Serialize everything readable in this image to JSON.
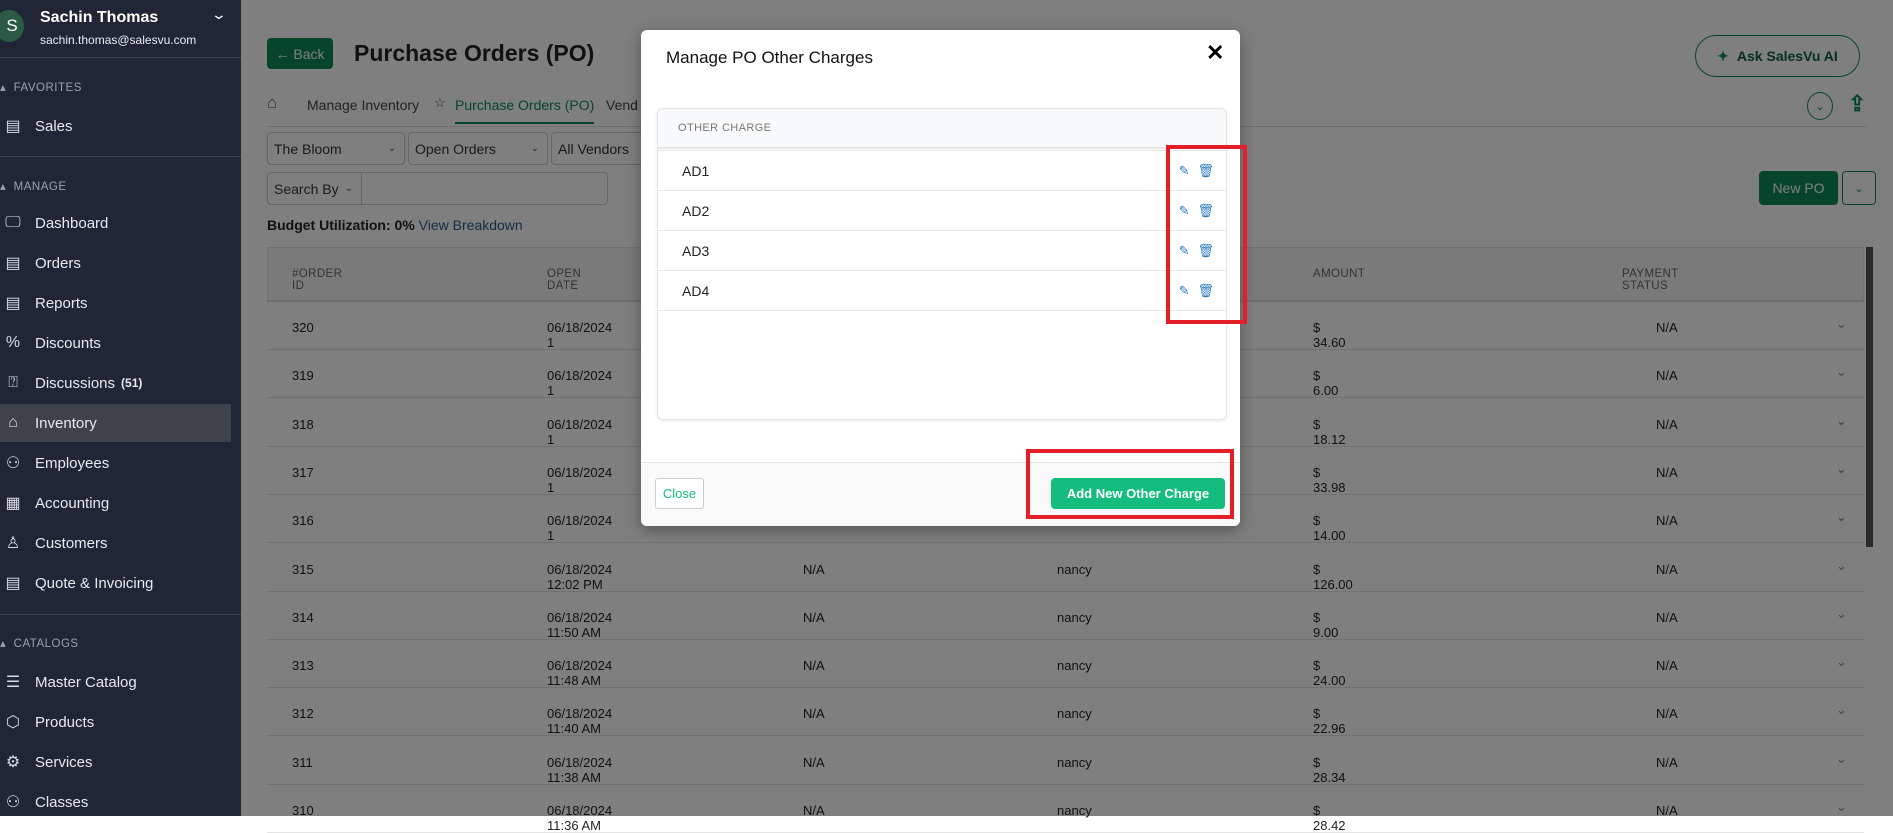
{
  "user": {
    "initial": "S",
    "name": "Sachin Thomas",
    "email": "sachin.thomas@salesvu.com"
  },
  "sidebar": {
    "sections": [
      {
        "label": "FAVORITES"
      },
      {
        "label": "MANAGE"
      },
      {
        "label": "CATALOGS"
      }
    ],
    "favorites": [
      {
        "label": "Sales",
        "icon": "sales-report-icon"
      }
    ],
    "manage": [
      {
        "label": "Dashboard",
        "icon": "monitor-icon"
      },
      {
        "label": "Orders",
        "icon": "orders-icon"
      },
      {
        "label": "Reports",
        "icon": "reports-icon"
      },
      {
        "label": "Discounts",
        "icon": "percent-icon"
      },
      {
        "label": "Discussions",
        "badge": "(51)",
        "icon": "chat-question-icon"
      },
      {
        "label": "Inventory",
        "icon": "store-icon",
        "active": true
      },
      {
        "label": "Employees",
        "icon": "people-icon"
      },
      {
        "label": "Accounting",
        "icon": "calculator-icon"
      },
      {
        "label": "Customers",
        "icon": "customer-icon"
      },
      {
        "label": "Quote & Invoicing",
        "icon": "invoice-icon"
      }
    ],
    "catalogs": [
      {
        "label": "Master Catalog",
        "icon": "list-icon"
      },
      {
        "label": "Products",
        "icon": "box-icon"
      },
      {
        "label": "Services",
        "icon": "gear-wrench-icon"
      },
      {
        "label": "Classes",
        "icon": "group-icon"
      }
    ]
  },
  "header": {
    "back": "Back",
    "title": "Purchase Orders (PO)",
    "ask_ai": "Ask SalesVu AI"
  },
  "breadcrumb": {
    "home": "Manage Inventory",
    "current": "Purchase Orders (PO)",
    "next": "Vend"
  },
  "filters": {
    "location": "The Bloom",
    "status": "Open Orders",
    "vendor": "All Vendors",
    "search_by": "Search By",
    "search_value": ""
  },
  "new_po": "New PO",
  "budget": {
    "label": "Budget Utilization: 0%",
    "link": "View Breakdown"
  },
  "table": {
    "headers": {
      "order_id": "#ORDER ID",
      "open_date": "OPEN DATE",
      "amount": "AMOUNT",
      "payment_status": "PAYMENT STATUS"
    },
    "rows": [
      {
        "id": "320",
        "date": "06/18/2024 1",
        "c3": "",
        "c4": "",
        "amount": "$ 34.60",
        "status": "N/A"
      },
      {
        "id": "319",
        "date": "06/18/2024 1",
        "c3": "",
        "c4": "",
        "amount": "$ 6.00",
        "status": "N/A"
      },
      {
        "id": "318",
        "date": "06/18/2024 1",
        "c3": "",
        "c4": "",
        "amount": "$ 18.12",
        "status": "N/A"
      },
      {
        "id": "317",
        "date": "06/18/2024 1",
        "c3": "",
        "c4": "",
        "amount": "$ 33.98",
        "status": "N/A"
      },
      {
        "id": "316",
        "date": "06/18/2024 1",
        "c3": "",
        "c4": "",
        "amount": "$ 14.00",
        "status": "N/A"
      },
      {
        "id": "315",
        "date": "06/18/2024 12:02 PM",
        "c3": "N/A",
        "c4": "nancy",
        "amount": "$ 126.00",
        "status": "N/A"
      },
      {
        "id": "314",
        "date": "06/18/2024 11:50 AM",
        "c3": "N/A",
        "c4": "nancy",
        "amount": "$ 9.00",
        "status": "N/A"
      },
      {
        "id": "313",
        "date": "06/18/2024 11:48 AM",
        "c3": "N/A",
        "c4": "nancy",
        "amount": "$ 24.00",
        "status": "N/A"
      },
      {
        "id": "312",
        "date": "06/18/2024 11:40 AM",
        "c3": "N/A",
        "c4": "nancy",
        "amount": "$ 22.96",
        "status": "N/A"
      },
      {
        "id": "311",
        "date": "06/18/2024 11:38 AM",
        "c3": "N/A",
        "c4": "nancy",
        "amount": "$ 28.34",
        "status": "N/A"
      },
      {
        "id": "310",
        "date": "06/18/2024 11:36 AM",
        "c3": "N/A",
        "c4": "nancy",
        "amount": "$ 28.42",
        "status": "N/A"
      }
    ]
  },
  "modal": {
    "title": "Manage PO Other Charges",
    "column": "OTHER CHARGE",
    "charges": [
      "AD1",
      "AD2",
      "AD3",
      "AD4"
    ],
    "close": "Close",
    "add": "Add New Other Charge"
  },
  "colors": {
    "brand_green": "#0e8a57",
    "accent_green": "#15bd7d",
    "sidebar_bg": "#1f2737",
    "highlight_red": "#e41e26",
    "icon_blue": "#2f7bc4"
  }
}
